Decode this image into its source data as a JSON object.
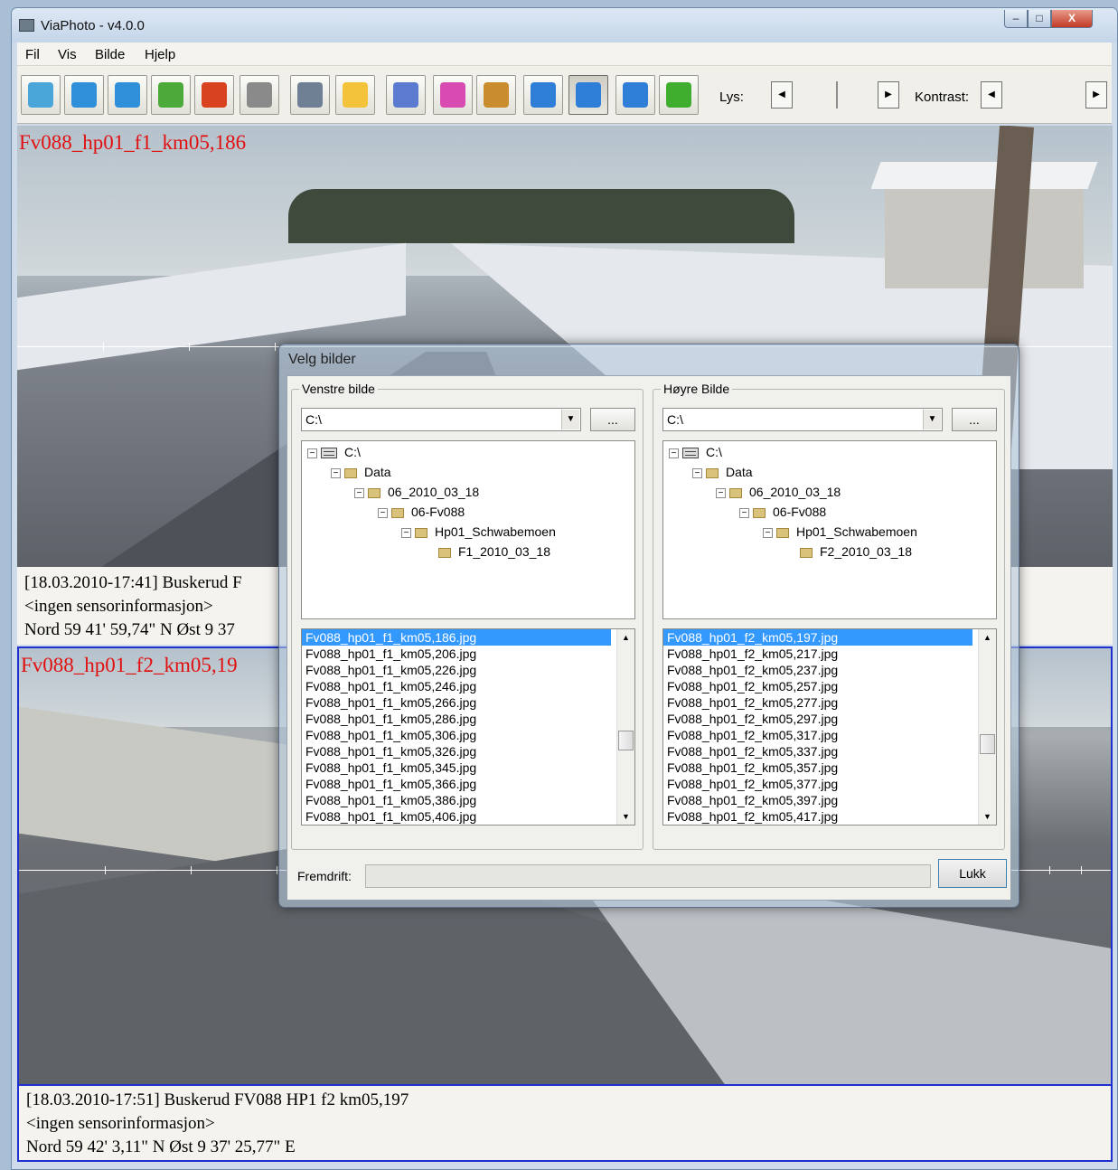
{
  "window": {
    "title": "ViaPhoto - v4.0.0",
    "controls": {
      "minimize": "–",
      "maximize": "□",
      "close": "X"
    }
  },
  "menu": [
    "Fil",
    "Vis",
    "Bilde",
    "Hjelp"
  ],
  "toolbar": {
    "buttons": [
      {
        "name": "open-image-icon",
        "color": "#4aa6d9"
      },
      {
        "name": "undo-arrow-icon",
        "color": "#2f8fd8"
      },
      {
        "name": "redo-arrow-icon",
        "color": "#2f8fd8"
      },
      {
        "name": "swap-arrows-icon",
        "color": "#4caa3a"
      },
      {
        "name": "car-icon",
        "color": "#d8421f"
      },
      {
        "name": "stop-sign-icon",
        "color": "#8a8a8a"
      },
      {
        "name": "printer-icon",
        "color": "#6f7f94"
      },
      {
        "name": "mail-icon",
        "color": "#f2c33b"
      },
      {
        "name": "copy-icon",
        "color": "#5a7bd0"
      },
      {
        "name": "checklist-icon",
        "color": "#d84bb0"
      },
      {
        "name": "film-reel-icon",
        "color": "#c98d2d"
      },
      {
        "name": "single-view-icon",
        "color": "#2f7fd8"
      },
      {
        "name": "split-view-icon",
        "color": "#2f7fd8"
      },
      {
        "name": "grid-view-icon",
        "color": "#2f7fd8"
      },
      {
        "name": "refresh-icon",
        "color": "#3fae2f"
      }
    ],
    "lys_label": "Lys:",
    "kontrast_label": "Kontrast:",
    "scroll_left": "◀",
    "scroll_right": "▶"
  },
  "photo1": {
    "overlay_label": "Fv088_hp01_f1_km05,186",
    "info": [
      "[18.03.2010-17:41]  Buskerud F",
      "<ingen sensorinformasjon>",
      "Nord 59 41' 59,74\" N   Øst 9 37"
    ]
  },
  "photo2": {
    "overlay_label": "Fv088_hp01_f2_km05,19",
    "info": [
      "[18.03.2010-17:51]  Buskerud FV088 HP1 f2 km05,197",
      "<ingen sensorinformasjon>",
      "Nord 59 42' 3,11\" N   Øst 9 37' 25,77\" E"
    ]
  },
  "dialog": {
    "title": "Velg bilder",
    "left": {
      "legend": "Venstre bilde",
      "drive": "C:\\",
      "browse": "...",
      "tree": [
        {
          "label": "C:\\",
          "toggle": "⊟",
          "type": "drive"
        },
        {
          "label": "Data",
          "toggle": "⊟",
          "type": "folder"
        },
        {
          "label": "06_2010_03_18",
          "toggle": "⊟",
          "type": "folder"
        },
        {
          "label": "06-Fv088",
          "toggle": "⊟",
          "type": "folder"
        },
        {
          "label": "Hp01_Schwabemoen",
          "toggle": "⊟",
          "type": "folder"
        },
        {
          "label": "F1_2010_03_18",
          "toggle": "",
          "type": "folder"
        }
      ],
      "files": [
        "Fv088_hp01_f1_km05,186.jpg",
        "Fv088_hp01_f1_km05,206.jpg",
        "Fv088_hp01_f1_km05,226.jpg",
        "Fv088_hp01_f1_km05,246.jpg",
        "Fv088_hp01_f1_km05,266.jpg",
        "Fv088_hp01_f1_km05,286.jpg",
        "Fv088_hp01_f1_km05,306.jpg",
        "Fv088_hp01_f1_km05,326.jpg",
        "Fv088_hp01_f1_km05,345.jpg",
        "Fv088_hp01_f1_km05,366.jpg",
        "Fv088_hp01_f1_km05,386.jpg",
        "Fv088_hp01_f1_km05,406.jpg"
      ]
    },
    "right": {
      "legend": "Høyre Bilde",
      "drive": "C:\\",
      "browse": "...",
      "tree": [
        {
          "label": "C:\\",
          "toggle": "⊟",
          "type": "drive"
        },
        {
          "label": "Data",
          "toggle": "⊟",
          "type": "folder"
        },
        {
          "label": "06_2010_03_18",
          "toggle": "⊟",
          "type": "folder"
        },
        {
          "label": "06-Fv088",
          "toggle": "⊟",
          "type": "folder"
        },
        {
          "label": "Hp01_Schwabemoen",
          "toggle": "⊟",
          "type": "folder"
        },
        {
          "label": "F2_2010_03_18",
          "toggle": "",
          "type": "folder"
        }
      ],
      "files": [
        "Fv088_hp01_f2_km05,197.jpg",
        "Fv088_hp01_f2_km05,217.jpg",
        "Fv088_hp01_f2_km05,237.jpg",
        "Fv088_hp01_f2_km05,257.jpg",
        "Fv088_hp01_f2_km05,277.jpg",
        "Fv088_hp01_f2_km05,297.jpg",
        "Fv088_hp01_f2_km05,317.jpg",
        "Fv088_hp01_f2_km05,337.jpg",
        "Fv088_hp01_f2_km05,357.jpg",
        "Fv088_hp01_f2_km05,377.jpg",
        "Fv088_hp01_f2_km05,397.jpg",
        "Fv088_hp01_f2_km05,417.jpg"
      ]
    },
    "progress_label": "Fremdrift:",
    "close_label": "Lukk",
    "scroll_up": "▲",
    "scroll_down": "▼",
    "combo_arrow": "▼"
  }
}
